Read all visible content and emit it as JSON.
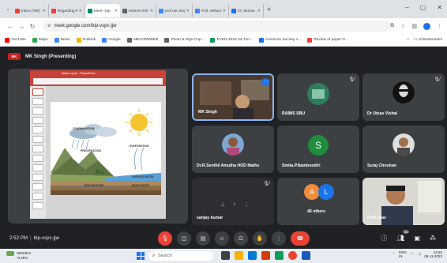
{
  "browser": {
    "tabs": [
      {
        "label": "Inbox (759) - pra",
        "color": "#ea4335",
        "active": false
      },
      {
        "label": "Regarding RDF",
        "color": "#ea4335",
        "active": false
      },
      {
        "label": "Meet - bip-",
        "color": "#00897b",
        "active": true
      },
      {
        "label": "INDIAN INSTIT",
        "color": "#5f6368",
        "active": false
      },
      {
        "label": "prof mK Singh -",
        "color": "#4285f4",
        "active": false
      },
      {
        "label": "Prof. Mrituniya",
        "color": "#4285f4",
        "active": false
      },
      {
        "label": "IIT Jammu",
        "color": "#1a73e8",
        "active": false
      }
    ],
    "new_tab": "+",
    "window_controls": [
      "⌄",
      "–",
      "▢",
      "✕"
    ],
    "url": "meet.google.com/bip-vspc-jjw",
    "bookmarks": [
      {
        "label": "YouTube",
        "color": "#ff0000"
      },
      {
        "label": "Maps",
        "color": "#34a853"
      },
      {
        "label": "News",
        "color": "#4285f4"
      },
      {
        "label": "Outlook",
        "color": "#f4b400"
      },
      {
        "label": "Google",
        "color": "#4285f4"
      },
      {
        "label": "SBUCRMWEB",
        "color": "#5f6368"
      },
      {
        "label": "Photo & Sign Cop...",
        "color": "#5f6368"
      },
      {
        "label": "EVEN 2022-23-Tim...",
        "color": "#0f9d58"
      },
      {
        "label": "American Society o...",
        "color": "#1a73e8"
      },
      {
        "label": "Review of paper G...",
        "color": "#ea4335"
      }
    ],
    "all_bookmarks": "All Bookmarks"
  },
  "meet": {
    "presenter_badge": "MK",
    "presenter_title": "MK Singh (Presenting)",
    "slide_labels": {
      "condensation": "CONDENSATION",
      "evaporation": "EVAPORATION",
      "precipitation": "PRECIPITATION",
      "surface_water": "SURFACE WATER",
      "groundwater": "GROUNDWATER",
      "river_water": "RIVER WATER"
    },
    "ppt_title": "Water cycle - PowerPoint",
    "participants": [
      {
        "name": "MK Singh",
        "speaking": true
      },
      {
        "name": "RAIMS SBU"
      },
      {
        "name": "Dr Utsav Vishal"
      },
      {
        "name": "Dr.R.Senthil Amutha HOD Maths"
      },
      {
        "name": "Smita.P.Namboodiri",
        "letter": "S"
      },
      {
        "name": "Suraj Chouhan"
      },
      {
        "name": "sanjay kumar"
      },
      {
        "name": "45 others",
        "letters": [
          "A",
          "L"
        ]
      },
      {
        "name": "Pintu Das"
      }
    ],
    "time": "2:52 PM",
    "meeting_code": "bip-vspc-jjw",
    "people_count": "54"
  },
  "taskbar": {
    "weather_temp": "SENSEX",
    "weather_value": "-0.25%",
    "search_placeholder": "Search",
    "lang": "ENG\nIN",
    "time": "14:52",
    "date": "08-11-2023"
  }
}
